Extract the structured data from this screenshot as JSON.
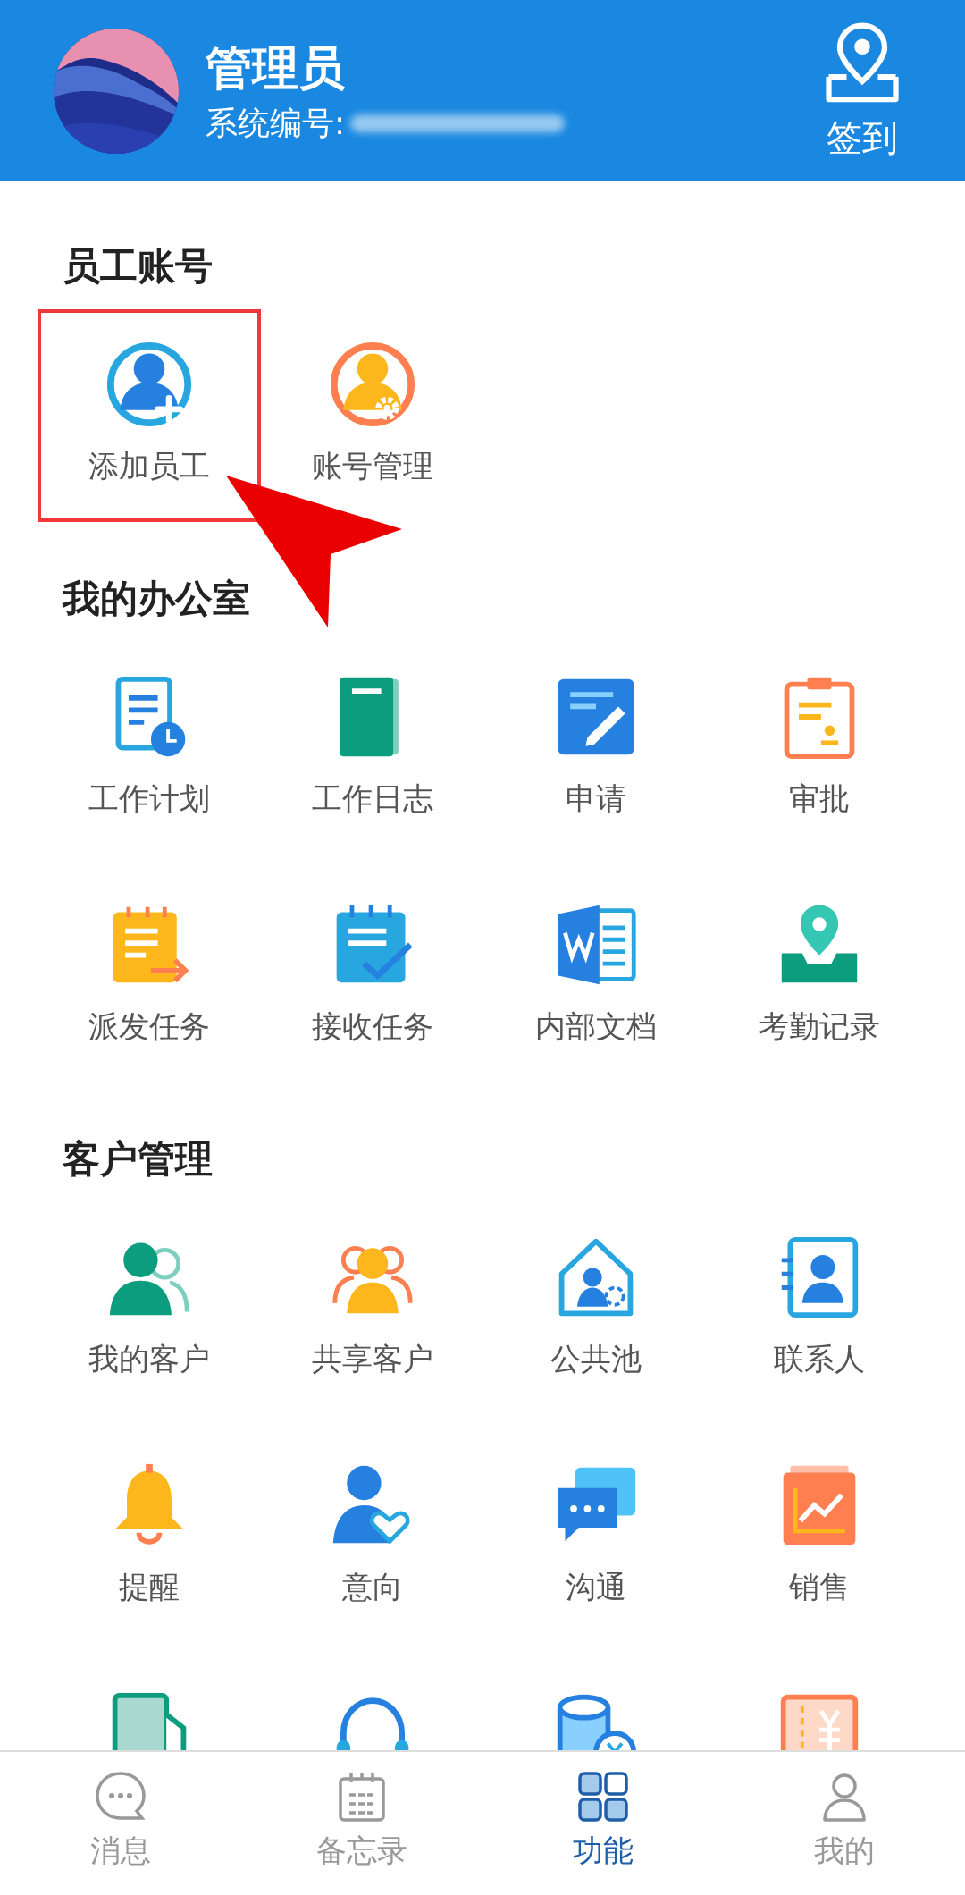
{
  "header": {
    "title": "管理员",
    "id_label": "系统编号:",
    "checkin": {
      "label": "签到"
    }
  },
  "annotation_arrow": true,
  "sections": [
    {
      "title": "员工账号",
      "items": [
        {
          "label": "添加员工",
          "kind": "person-plus",
          "highlighted": true
        },
        {
          "label": "账号管理",
          "kind": "person-gear",
          "highlighted": false
        }
      ]
    },
    {
      "title": "我的办公室",
      "items": [
        {
          "label": "工作计划",
          "kind": "doc-clock",
          "highlighted": false
        },
        {
          "label": "工作日志",
          "kind": "book",
          "highlighted": false
        },
        {
          "label": "申请",
          "kind": "pen-square",
          "highlighted": false
        },
        {
          "label": "审批",
          "kind": "clipboard",
          "highlighted": false
        },
        {
          "label": "派发任务",
          "kind": "note-arrow",
          "highlighted": false
        },
        {
          "label": "接收任务",
          "kind": "calendar-check",
          "highlighted": false
        },
        {
          "label": "内部文档",
          "kind": "word-doc",
          "highlighted": false
        },
        {
          "label": "考勤记录",
          "kind": "pin-tray",
          "highlighted": false
        }
      ]
    },
    {
      "title": "客户管理",
      "items": [
        {
          "label": "我的客户",
          "kind": "people-green",
          "highlighted": false
        },
        {
          "label": "共享客户",
          "kind": "people-orange",
          "highlighted": false
        },
        {
          "label": "公共池",
          "kind": "house",
          "highlighted": false
        },
        {
          "label": "联系人",
          "kind": "contact-card",
          "highlighted": false
        },
        {
          "label": "提醒",
          "kind": "bell",
          "highlighted": false
        },
        {
          "label": "意向",
          "kind": "person-heart",
          "highlighted": false
        },
        {
          "label": "沟通",
          "kind": "chat",
          "highlighted": false
        },
        {
          "label": "销售",
          "kind": "chart",
          "highlighted": false
        },
        {
          "kind": "file-green",
          "highlighted": false
        },
        {
          "kind": "headset",
          "highlighted": false
        },
        {
          "kind": "coins",
          "highlighted": false
        },
        {
          "kind": "receipt",
          "highlighted": false
        }
      ]
    }
  ],
  "tabs": [
    {
      "label": "消息",
      "kind": "chat",
      "selected": false
    },
    {
      "label": "备忘录",
      "kind": "calendar",
      "selected": false
    },
    {
      "label": "功能",
      "kind": "grid",
      "selected": true
    },
    {
      "label": "我的",
      "kind": "user",
      "selected": false
    }
  ]
}
